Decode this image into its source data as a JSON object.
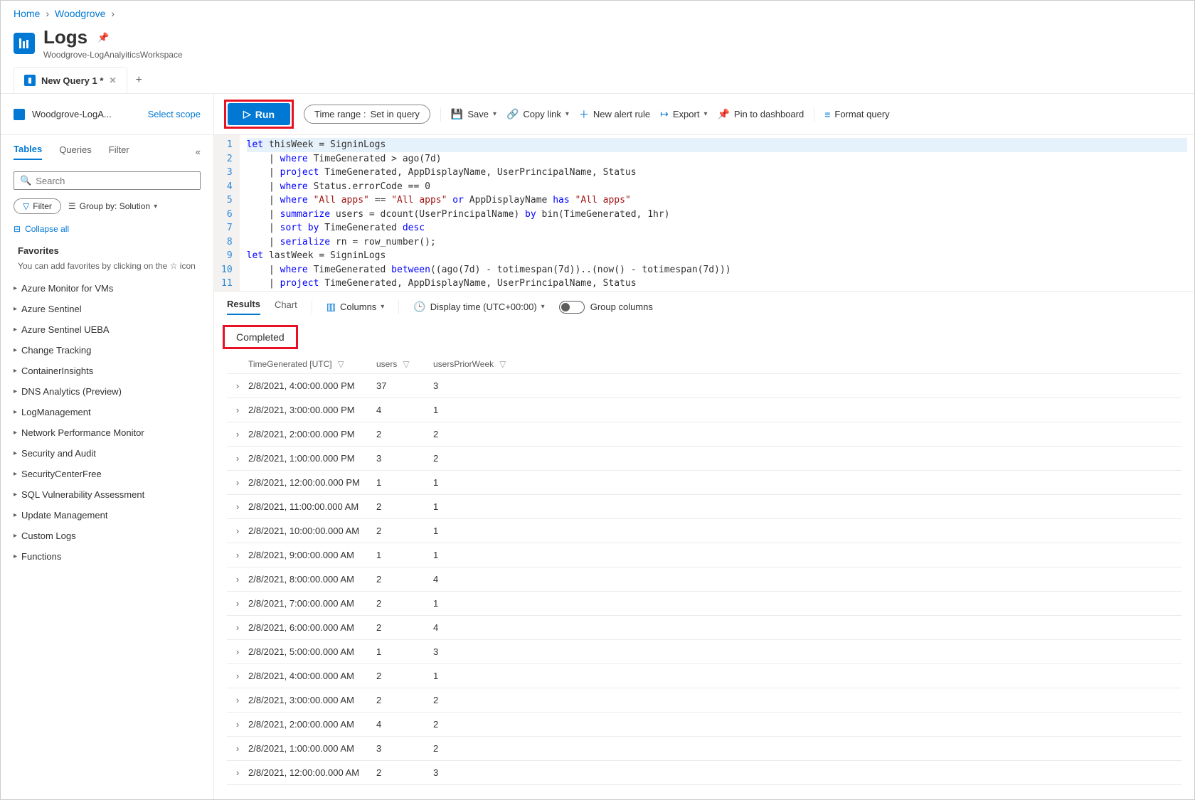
{
  "breadcrumb": {
    "home": "Home",
    "workspace": "Woodgrove"
  },
  "header": {
    "title": "Logs",
    "subtitle": "Woodgrove-LogAnalyiticsWorkspace"
  },
  "tab": {
    "label": "New Query 1 *"
  },
  "scope": {
    "name": "Woodgrove-LogA...",
    "select": "Select scope"
  },
  "toolbar": {
    "run": "Run",
    "timerange_label": "Time range :",
    "timerange_value": "Set in query",
    "save": "Save",
    "copylink": "Copy link",
    "newalert": "New alert rule",
    "export": "Export",
    "pin": "Pin to dashboard",
    "format": "Format query"
  },
  "sidebar": {
    "tabs": {
      "tables": "Tables",
      "queries": "Queries",
      "filter": "Filter"
    },
    "search_placeholder": "Search",
    "filter_btn": "Filter",
    "groupby": "Group by: Solution",
    "collapse_all": "Collapse all",
    "favorites_title": "Favorites",
    "favorites_text": "You can add favorites by clicking on the ☆ icon",
    "tree": [
      "Azure Monitor for VMs",
      "Azure Sentinel",
      "Azure Sentinel UEBA",
      "Change Tracking",
      "ContainerInsights",
      "DNS Analytics (Preview)",
      "LogManagement",
      "Network Performance Monitor",
      "Security and Audit",
      "SecurityCenterFree",
      "SQL Vulnerability Assessment",
      "Update Management",
      "Custom Logs",
      "Functions"
    ]
  },
  "query_lines": [
    "let thisWeek = SigninLogs",
    "    | where TimeGenerated > ago(7d)",
    "    | project TimeGenerated, AppDisplayName, UserPrincipalName, Status",
    "    | where Status.errorCode == 0",
    "    | where \"All apps\" == \"All apps\" or AppDisplayName has \"All apps\"",
    "    | summarize users = dcount(UserPrincipalName) by bin(TimeGenerated, 1hr)",
    "    | sort by TimeGenerated desc",
    "    | serialize rn = row_number();",
    "let lastWeek = SigninLogs",
    "    | where TimeGenerated between((ago(7d) - totimespan(7d))..(now() - totimespan(7d)))",
    "    | project TimeGenerated, AppDisplayName, UserPrincipalName, Status"
  ],
  "results": {
    "tabs": {
      "results": "Results",
      "chart": "Chart"
    },
    "columns_btn": "Columns",
    "display_time": "Display time (UTC+00:00)",
    "group_columns": "Group columns",
    "status": "Completed",
    "headers": {
      "time": "TimeGenerated [UTC]",
      "users": "users",
      "prior": "usersPriorWeek"
    },
    "rows": [
      {
        "time": "2/8/2021, 4:00:00.000 PM",
        "users": "37",
        "prior": "3"
      },
      {
        "time": "2/8/2021, 3:00:00.000 PM",
        "users": "4",
        "prior": "1"
      },
      {
        "time": "2/8/2021, 2:00:00.000 PM",
        "users": "2",
        "prior": "2"
      },
      {
        "time": "2/8/2021, 1:00:00.000 PM",
        "users": "3",
        "prior": "2"
      },
      {
        "time": "2/8/2021, 12:00:00.000 PM",
        "users": "1",
        "prior": "1"
      },
      {
        "time": "2/8/2021, 11:00:00.000 AM",
        "users": "2",
        "prior": "1"
      },
      {
        "time": "2/8/2021, 10:00:00.000 AM",
        "users": "2",
        "prior": "1"
      },
      {
        "time": "2/8/2021, 9:00:00.000 AM",
        "users": "1",
        "prior": "1"
      },
      {
        "time": "2/8/2021, 8:00:00.000 AM",
        "users": "2",
        "prior": "4"
      },
      {
        "time": "2/8/2021, 7:00:00.000 AM",
        "users": "2",
        "prior": "1"
      },
      {
        "time": "2/8/2021, 6:00:00.000 AM",
        "users": "2",
        "prior": "4"
      },
      {
        "time": "2/8/2021, 5:00:00.000 AM",
        "users": "1",
        "prior": "3"
      },
      {
        "time": "2/8/2021, 4:00:00.000 AM",
        "users": "2",
        "prior": "1"
      },
      {
        "time": "2/8/2021, 3:00:00.000 AM",
        "users": "2",
        "prior": "2"
      },
      {
        "time": "2/8/2021, 2:00:00.000 AM",
        "users": "4",
        "prior": "2"
      },
      {
        "time": "2/8/2021, 1:00:00.000 AM",
        "users": "3",
        "prior": "2"
      },
      {
        "time": "2/8/2021, 12:00:00.000 AM",
        "users": "2",
        "prior": "3"
      }
    ]
  }
}
